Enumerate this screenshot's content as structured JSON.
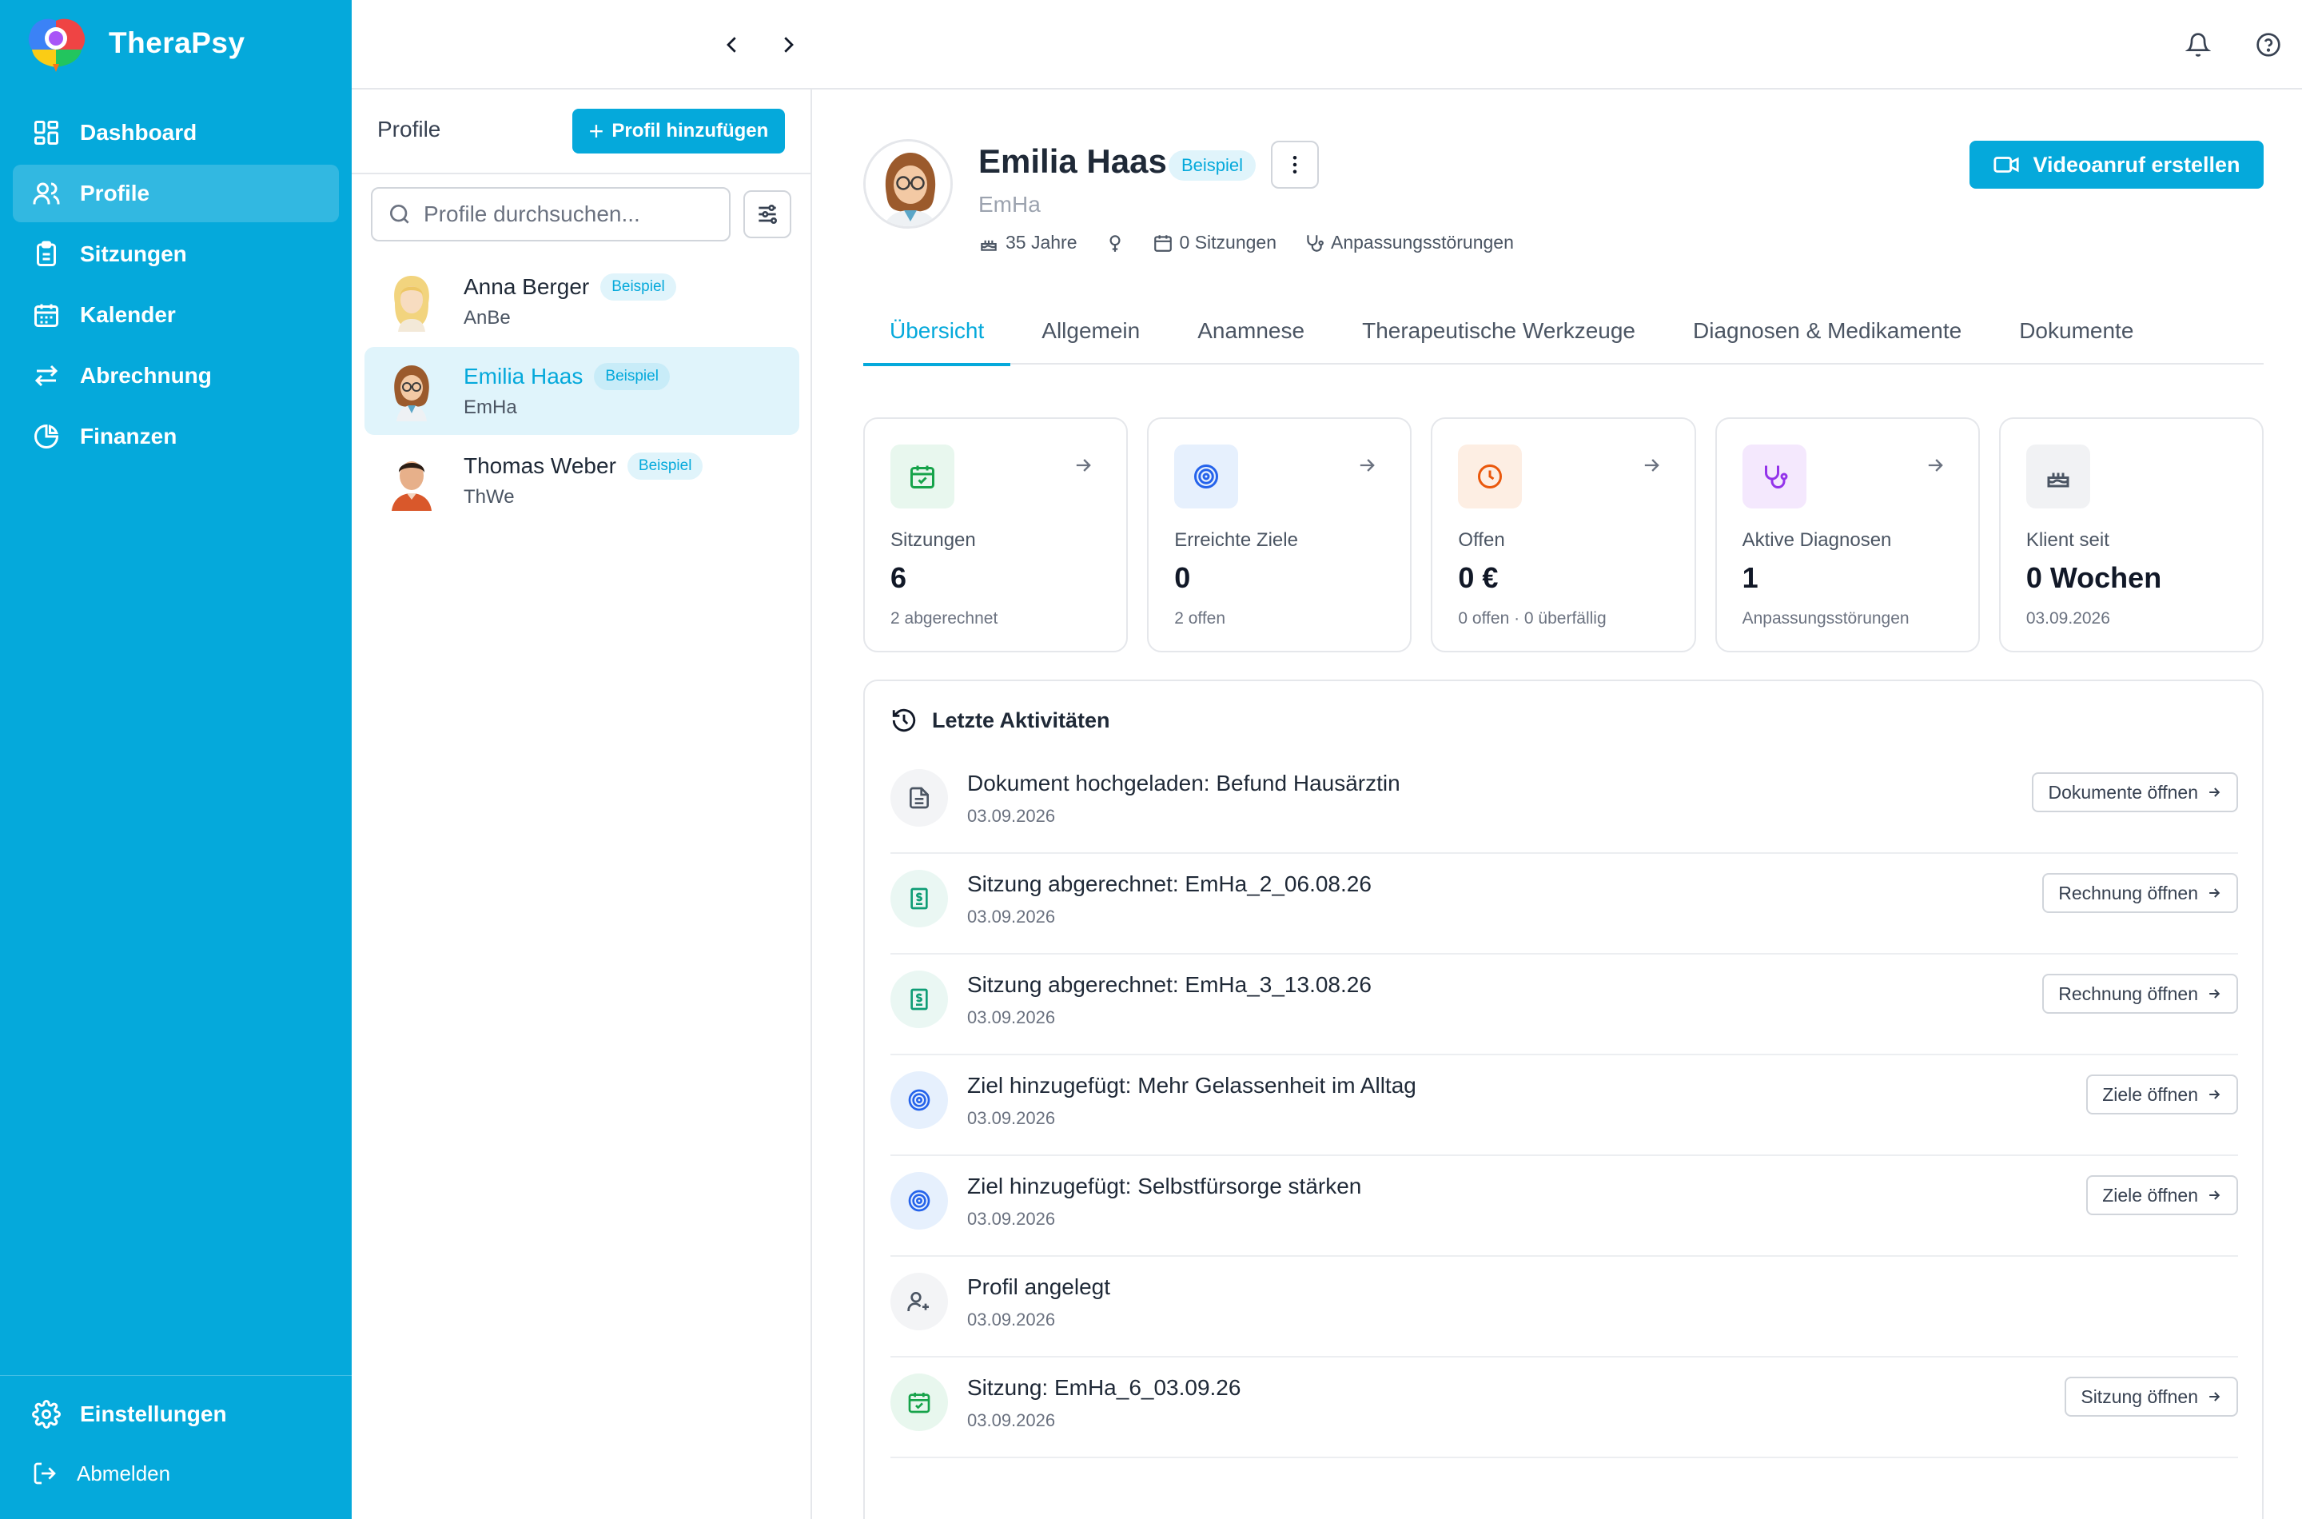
{
  "app": {
    "name": "TheraPsy"
  },
  "sidebar": {
    "items": [
      {
        "label": "Dashboard",
        "icon": "dashboard-icon"
      },
      {
        "label": "Profile",
        "icon": "users-icon",
        "active": true
      },
      {
        "label": "Sitzungen",
        "icon": "clipboard-icon"
      },
      {
        "label": "Kalender",
        "icon": "calendar-icon"
      },
      {
        "label": "Abrechnung",
        "icon": "transfer-arrows-icon"
      },
      {
        "label": "Finanzen",
        "icon": "pie-chart-icon"
      }
    ],
    "settings_label": "Einstellungen",
    "logout_label": "Abmelden"
  },
  "list": {
    "title": "Profile",
    "add_label": "Profil hinzufügen",
    "search_placeholder": "Profile durchsuchen...",
    "profiles": [
      {
        "name": "Anna Berger",
        "short": "AnBe",
        "badge": "Beispiel"
      },
      {
        "name": "Emilia Haas",
        "short": "EmHa",
        "badge": "Beispiel",
        "active": true
      },
      {
        "name": "Thomas Weber",
        "short": "ThWe",
        "badge": "Beispiel"
      }
    ]
  },
  "detail": {
    "name": "Emilia Haas",
    "badge": "Beispiel",
    "short": "EmHa",
    "age": "35 Jahre",
    "sessions": "0 Sitzungen",
    "diagnosis": "Anpassungsstörungen",
    "video_label": "Videoanruf erstellen"
  },
  "tabs": [
    "Übersicht",
    "Allgemein",
    "Anamnese",
    "Therapeutische Werkzeuge",
    "Diagnosen & Medikamente",
    "Dokumente"
  ],
  "stats": [
    {
      "label": "Sitzungen",
      "value": "6",
      "sub": "2 abgerechnet",
      "icon": "calendar-check-icon",
      "color": "#16a34a",
      "bg": "#e8f7ee"
    },
    {
      "label": "Erreichte Ziele",
      "value": "0",
      "sub": "2 offen",
      "icon": "target-icon",
      "color": "#2563eb",
      "bg": "#e6f0fd"
    },
    {
      "label": "Offen",
      "value": "0 €",
      "sub": "0 offen · 0 überfällig",
      "icon": "clock-icon",
      "color": "#ea580c",
      "bg": "#fdeee3"
    },
    {
      "label": "Aktive Diagnosen",
      "value": "1",
      "sub": "Anpassungsstörungen",
      "icon": "stethoscope-icon",
      "color": "#9333ea",
      "bg": "#f4e8fd"
    },
    {
      "label": "Klient seit",
      "value": "0 Wochen",
      "sub": "03.09.2026",
      "icon": "cake-icon",
      "color": "#4b5563",
      "bg": "#f1f2f4"
    }
  ],
  "activity": {
    "title": "Letzte Aktivitäten",
    "items": [
      {
        "title": "Dokument hochgeladen: Befund Hausärztin",
        "date": "03.09.2026",
        "button": "Dokumente öffnen",
        "icon": "document-icon"
      },
      {
        "title": "Sitzung abgerechnet: EmHa_2_06.08.26",
        "date": "03.09.2026",
        "button": "Rechnung öffnen",
        "icon": "invoice-icon"
      },
      {
        "title": "Sitzung abgerechnet: EmHa_3_13.08.26",
        "date": "03.09.2026",
        "button": "Rechnung öffnen",
        "icon": "invoice-icon"
      },
      {
        "title": "Ziel hinzugefügt: Mehr Gelassenheit im Alltag",
        "date": "03.09.2026",
        "button": "Ziele öffnen",
        "icon": "target-icon"
      },
      {
        "title": "Ziel hinzugefügt: Selbstfürsorge stärken",
        "date": "03.09.2026",
        "button": "Ziele öffnen",
        "icon": "target-icon"
      },
      {
        "title": "Profil angelegt",
        "date": "03.09.2026",
        "button": "",
        "icon": "user-plus-icon"
      },
      {
        "title": "Sitzung: EmHa_6_03.09.26",
        "date": "03.09.2026",
        "button": "Sitzung öffnen",
        "icon": "calendar-check-icon"
      }
    ]
  },
  "colors": {
    "brand": "#05a9db",
    "sidebar": "#05a9db",
    "active_bg": "#e0f4fb"
  }
}
